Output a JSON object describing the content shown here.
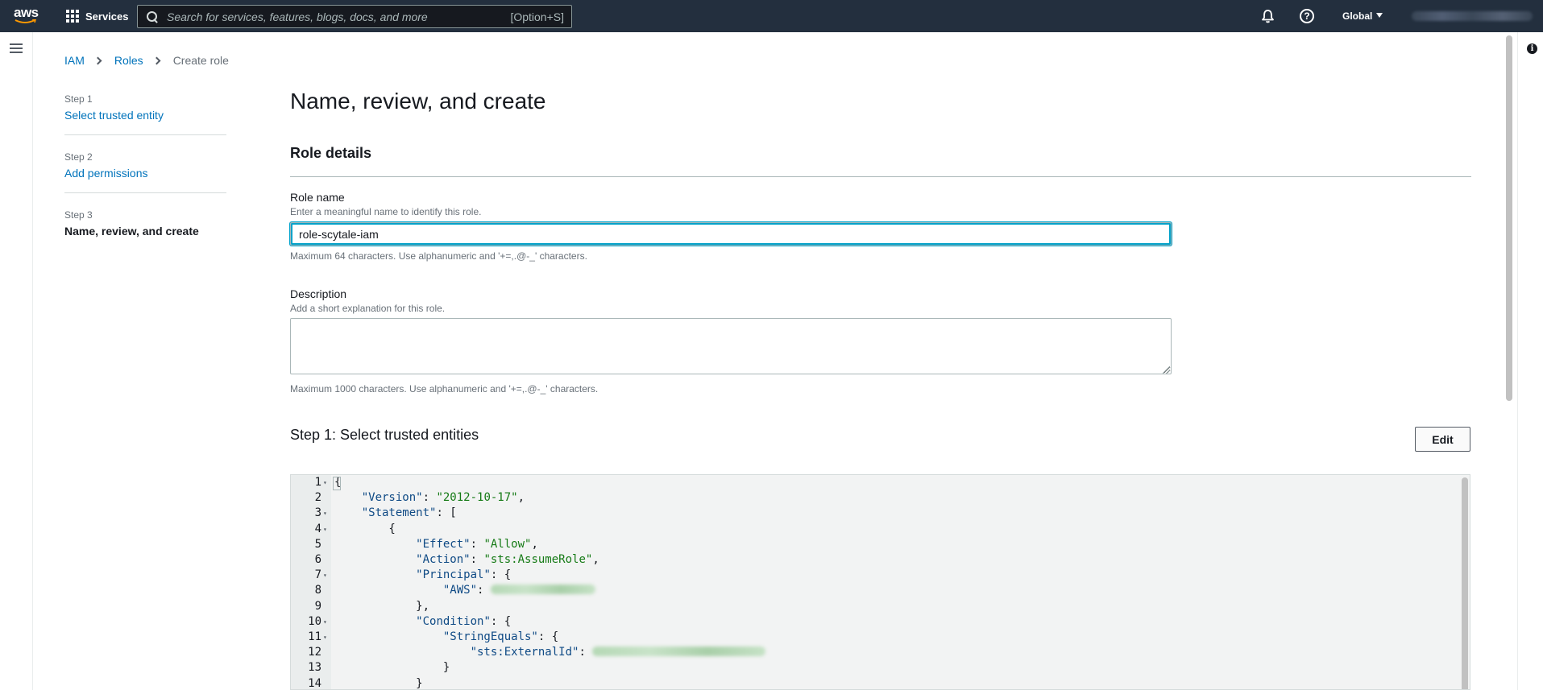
{
  "topnav": {
    "logo_text": "aws",
    "services_label": "Services",
    "search_placeholder": "Search for services, features, blogs, docs, and more",
    "search_shortcut": "[Option+S]",
    "region_label": "Global"
  },
  "breadcrumb": {
    "items": [
      "IAM",
      "Roles",
      "Create role"
    ]
  },
  "wizard_steps": [
    {
      "number": "Step 1",
      "label": "Select trusted entity"
    },
    {
      "number": "Step 2",
      "label": "Add permissions"
    },
    {
      "number": "Step 3",
      "label": "Name, review, and create"
    }
  ],
  "page_title": "Name, review, and create",
  "role_details": {
    "heading": "Role details",
    "role_name_label": "Role name",
    "role_name_desc": "Enter a meaningful name to identify this role.",
    "role_name_value": "role-scytale-iam",
    "role_name_constraint": "Maximum 64 characters. Use alphanumeric and '+=,.@-_' characters.",
    "description_label": "Description",
    "description_desc": "Add a short explanation for this role.",
    "description_value": "",
    "description_constraint": "Maximum 1000 characters. Use alphanumeric and '+=,.@-_' characters."
  },
  "trusted_entities": {
    "heading": "Step 1: Select trusted entities",
    "edit_label": "Edit",
    "code_lines": [
      {
        "n": "1",
        "fold": true,
        "parts": [
          {
            "t": "{"
          }
        ]
      },
      {
        "n": "2",
        "fold": false,
        "parts": [
          {
            "t": "    "
          },
          {
            "t": "\"Version\"",
            "c": "key"
          },
          {
            "t": ": "
          },
          {
            "t": "\"2012-10-17\"",
            "c": "str"
          },
          {
            "t": ","
          }
        ]
      },
      {
        "n": "3",
        "fold": true,
        "parts": [
          {
            "t": "    "
          },
          {
            "t": "\"Statement\"",
            "c": "key"
          },
          {
            "t": ": ["
          }
        ]
      },
      {
        "n": "4",
        "fold": true,
        "parts": [
          {
            "t": "        {"
          }
        ]
      },
      {
        "n": "5",
        "fold": false,
        "parts": [
          {
            "t": "            "
          },
          {
            "t": "\"Effect\"",
            "c": "key"
          },
          {
            "t": ": "
          },
          {
            "t": "\"Allow\"",
            "c": "str"
          },
          {
            "t": ","
          }
        ]
      },
      {
        "n": "6",
        "fold": false,
        "parts": [
          {
            "t": "            "
          },
          {
            "t": "\"Action\"",
            "c": "key"
          },
          {
            "t": ": "
          },
          {
            "t": "\"sts:AssumeRole\"",
            "c": "str"
          },
          {
            "t": ","
          }
        ]
      },
      {
        "n": "7",
        "fold": true,
        "parts": [
          {
            "t": "            "
          },
          {
            "t": "\"Principal\"",
            "c": "key"
          },
          {
            "t": ": {"
          }
        ]
      },
      {
        "n": "8",
        "fold": false,
        "parts": [
          {
            "t": "                "
          },
          {
            "t": "\"AWS\"",
            "c": "key"
          },
          {
            "t": ": "
          },
          {
            "blur": 130
          }
        ]
      },
      {
        "n": "9",
        "fold": false,
        "parts": [
          {
            "t": "            },"
          }
        ]
      },
      {
        "n": "10",
        "fold": true,
        "parts": [
          {
            "t": "            "
          },
          {
            "t": "\"Condition\"",
            "c": "key"
          },
          {
            "t": ": {"
          }
        ]
      },
      {
        "n": "11",
        "fold": true,
        "parts": [
          {
            "t": "                "
          },
          {
            "t": "\"StringEquals\"",
            "c": "key"
          },
          {
            "t": ": {"
          }
        ]
      },
      {
        "n": "12",
        "fold": false,
        "parts": [
          {
            "t": "                    "
          },
          {
            "t": "\"sts:ExternalId\"",
            "c": "key"
          },
          {
            "t": ": "
          },
          {
            "blur": 215
          }
        ]
      },
      {
        "n": "13",
        "fold": false,
        "parts": [
          {
            "t": "                }"
          }
        ]
      },
      {
        "n": "14",
        "fold": false,
        "parts": [
          {
            "t": "            }"
          }
        ]
      }
    ]
  },
  "colors": {
    "nav_bg": "#232f3e",
    "link": "#0073bb",
    "focus": "#00a1c9"
  },
  "icons": [
    "grid-icon",
    "search-icon",
    "bell-icon",
    "help-icon",
    "hamburger-icon",
    "info-icon",
    "chevron-right-icon"
  ]
}
